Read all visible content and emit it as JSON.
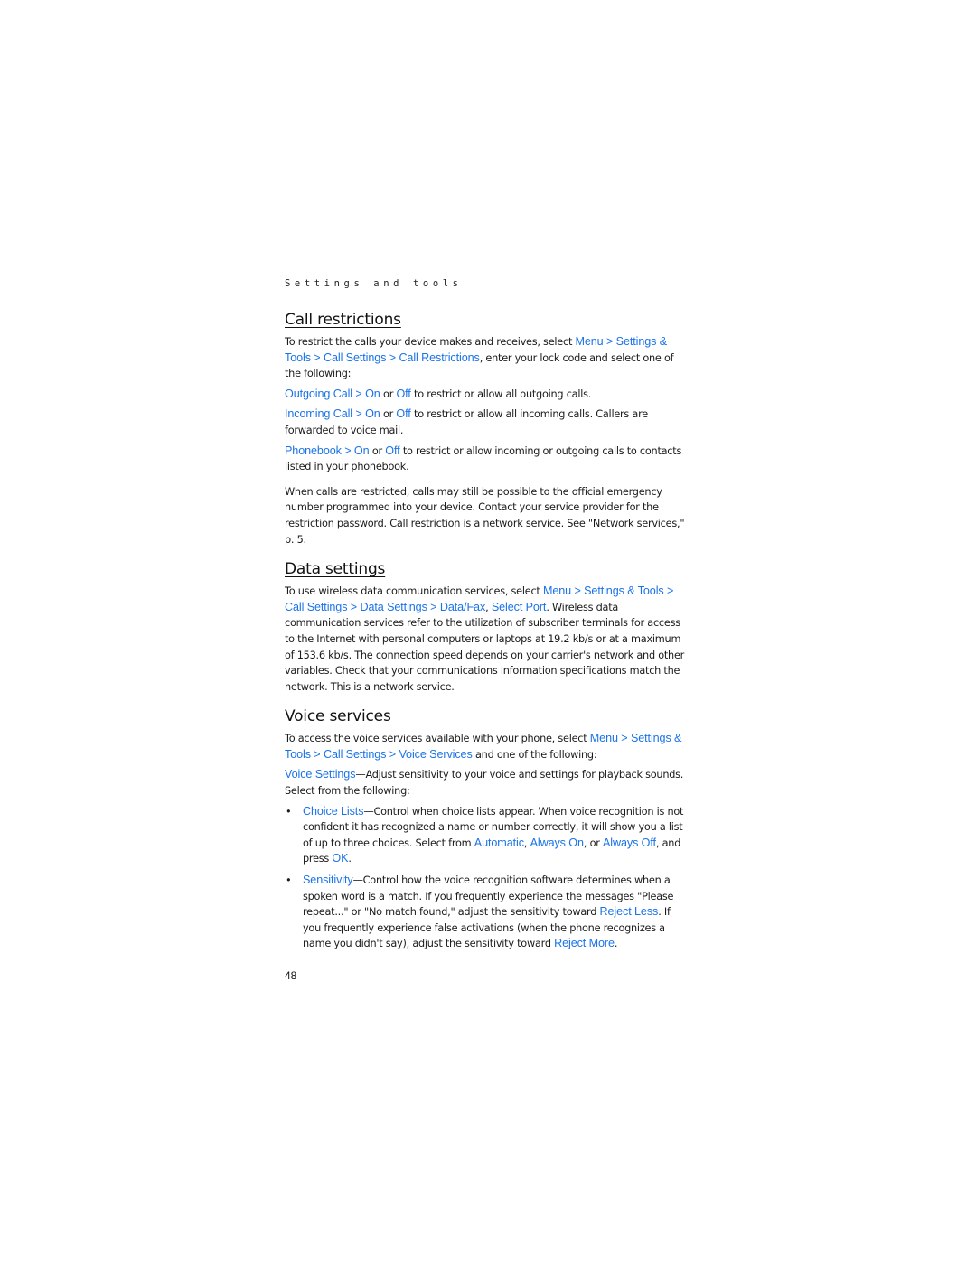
{
  "running_head": "Settings and tools",
  "link_color": "#1a73e8",
  "sections": {
    "call_restrictions": {
      "title": "Call restrictions",
      "intro": {
        "t1": "To restrict the calls your device makes and receives, select ",
        "l1": "Menu",
        "s1": " > ",
        "l2": "Settings & Tools",
        "s2": " > ",
        "l3": "Call Settings",
        "s3": " > ",
        "l4": "Call Restrictions",
        "t2": ", enter your lock code and select one of the following:"
      },
      "items": [
        {
          "name": "Outgoing Call",
          "sep": " > ",
          "on": "On",
          "or": " or ",
          "off": "Off",
          "desc": " to restrict or allow all outgoing calls."
        },
        {
          "name": "Incoming Call",
          "sep": " > ",
          "on": "On",
          "or": " or ",
          "off": "Off",
          "desc": " to restrict or allow all incoming calls. Callers are forwarded to voice mail."
        },
        {
          "name": "Phonebook",
          "sep": " > ",
          "on": "On",
          "or": " or ",
          "off": "Off",
          "desc": " to restrict or allow incoming or outgoing calls to contacts listed in your phonebook."
        }
      ],
      "note": "When calls are restricted, calls may still be possible to the official emergency number programmed into your device. Contact your service provider for the restriction password. Call restriction is a network service. See \"Network services,\" p. 5."
    },
    "data_settings": {
      "title": "Data settings",
      "t1": "To use wireless data communication services, select ",
      "l1": "Menu",
      "s1": " > ",
      "l2": "Settings & Tools",
      "s2": " > ",
      "l3": "Call Settings",
      "s3": " > ",
      "l4": "Data Settings",
      "s4": " > ",
      "l5": "Data/Fax",
      "s5": ", ",
      "l6": "Select Port",
      "t2": ". Wireless data communication services refer to the utilization of subscriber terminals for access to the Internet with personal computers or laptops at 19.2 kb/s or at a maximum of 153.6 kb/s. The connection speed depends on your carrier's network and other variables. Check that your communications information specifications match the network. This is a network service."
    },
    "voice_services": {
      "title": "Voice services",
      "intro": {
        "t1": "To access the voice services available with your phone, select ",
        "l1": "Menu",
        "s1": " > ",
        "l2": "Settings & Tools",
        "s2": " > ",
        "l3": "Call Settings",
        "s3": " > ",
        "l4": "Voice Services",
        "t2": " and one of the following:"
      },
      "voice_settings": {
        "name": "Voice Settings",
        "desc": "—Adjust sensitivity to your voice and settings for playback sounds. Select from the following:"
      },
      "bullets": {
        "bullet_char": "•",
        "choice_lists": {
          "name": "Choice Lists",
          "t1": "—Control when choice lists appear. When voice recognition is not confident it has recognized a name or number correctly, it will show you a list of up to three choices. Select from ",
          "o1": "Automatic",
          "c1": ", ",
          "o2": "Always On",
          "c2": ", or ",
          "o3": "Always Off",
          "t2": ", and press ",
          "ok": "OK",
          "t3": "."
        },
        "sensitivity": {
          "name": "Sensitivity",
          "t1": "—Control how the voice recognition software determines when a spoken word is a match. If you frequently experience the messages \"Please repeat...\" or \"No match found,\" adjust the sensitivity toward ",
          "o1": "Reject Less",
          "t2": ". If you frequently experience false activations (when the phone recognizes a name you didn't say), adjust the sensitivity toward ",
          "o2": "Reject More",
          "t3": "."
        }
      }
    }
  },
  "page_number": "48"
}
